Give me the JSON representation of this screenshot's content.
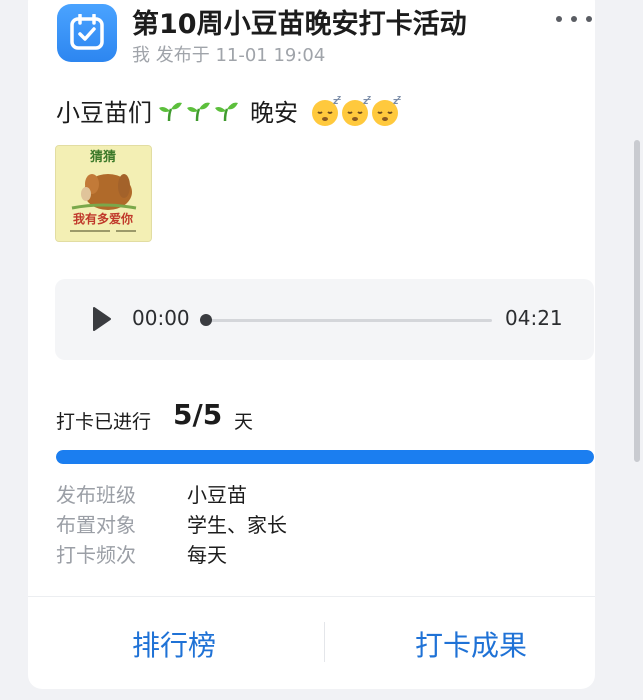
{
  "post": {
    "title": "第10周小豆苗晚安打卡活动",
    "meta": "我 发布于 11-01 19:04",
    "more_icon": "more-dots-icon",
    "app_icon": "calendar-check-icon"
  },
  "content": {
    "greeting_text": "小豆苗们",
    "greeting_suffix": "晚安",
    "sprout_icon": "seedling-emoji",
    "sleepy_icon": "sleeping-face-emoji",
    "book": {
      "top_text": "猜猜",
      "title_text": "我有多爱你"
    }
  },
  "audio": {
    "current_time": "00:00",
    "total_time": "04:21",
    "play_icon": "play-icon",
    "progress": 0
  },
  "checkin": {
    "label": "打卡已进行",
    "value": "5/5",
    "unit": "天",
    "progress_fraction": 1.0,
    "bar_color": "#1b7ef0"
  },
  "info": [
    {
      "label": "发布班级",
      "value": "小豆苗"
    },
    {
      "label": "布置对象",
      "value": "学生、家长"
    },
    {
      "label": "打卡频次",
      "value": "每天"
    }
  ],
  "actions": {
    "ranking_label": "排行榜",
    "results_label": "打卡成果",
    "color": "#1f72d6"
  }
}
